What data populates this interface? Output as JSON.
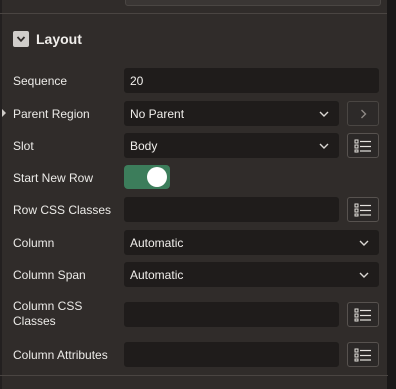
{
  "section": {
    "title": "Layout"
  },
  "fields": {
    "sequence": {
      "label": "Sequence",
      "value": "20"
    },
    "parent_region": {
      "label": "Parent Region",
      "value": "No Parent"
    },
    "slot": {
      "label": "Slot",
      "value": "Body"
    },
    "start_new_row": {
      "label": "Start New Row",
      "state": "on"
    },
    "row_css_classes": {
      "label": "Row CSS Classes",
      "value": ""
    },
    "column": {
      "label": "Column",
      "value": "Automatic"
    },
    "column_span": {
      "label": "Column Span",
      "value": "Automatic"
    },
    "column_css_classes": {
      "label_line1": "Column CSS",
      "label_line2": "Classes",
      "value": ""
    },
    "column_attributes": {
      "label": "Column Attributes",
      "value": ""
    }
  },
  "icons": {
    "collapse": "chevron-down-icon",
    "select": "chevron-down-icon",
    "go": "chevron-right-icon",
    "list": "list-icon"
  },
  "colors": {
    "toggle_on": "#3c7d5b",
    "field_bg": "#1f1c1b",
    "panel_bg": "#302c2a"
  }
}
